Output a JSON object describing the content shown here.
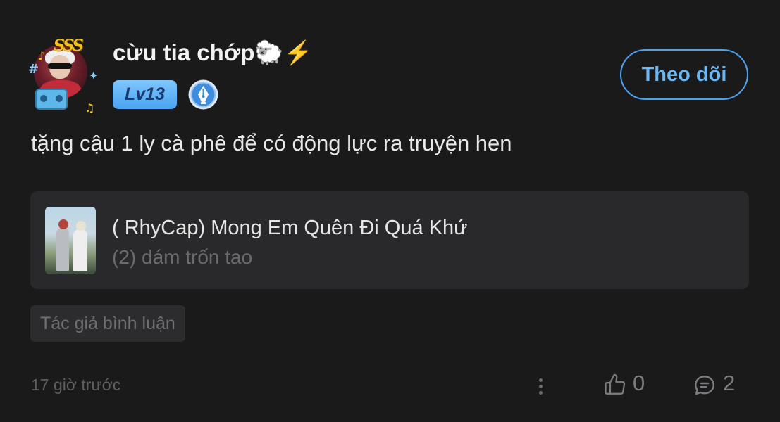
{
  "user": {
    "name": "cừu tia chớp🐑⚡",
    "level": "Lv13",
    "avatar_frame_text": "SSS"
  },
  "follow_button": {
    "label": "Theo dõi"
  },
  "comment": {
    "text": "tặng cậu 1 ly cà phê để có động lực ra truyện hen"
  },
  "story": {
    "title": "( RhyCap) Mong Em Quên Đi Quá Khứ",
    "chapter": "(2) dám trốn tao"
  },
  "tag": {
    "label": "Tác giả bình luận"
  },
  "footer": {
    "timestamp": "17 giờ trước",
    "likes": "0",
    "replies": "2"
  },
  "colors": {
    "background": "#1a1a1b",
    "accent": "#4aa3f0",
    "card": "#29292b"
  },
  "icons": {
    "author_badge": "pen-nib-icon",
    "like": "thumbs-up-icon",
    "reply": "comment-bubble-icon",
    "more": "vertical-ellipsis-icon"
  }
}
